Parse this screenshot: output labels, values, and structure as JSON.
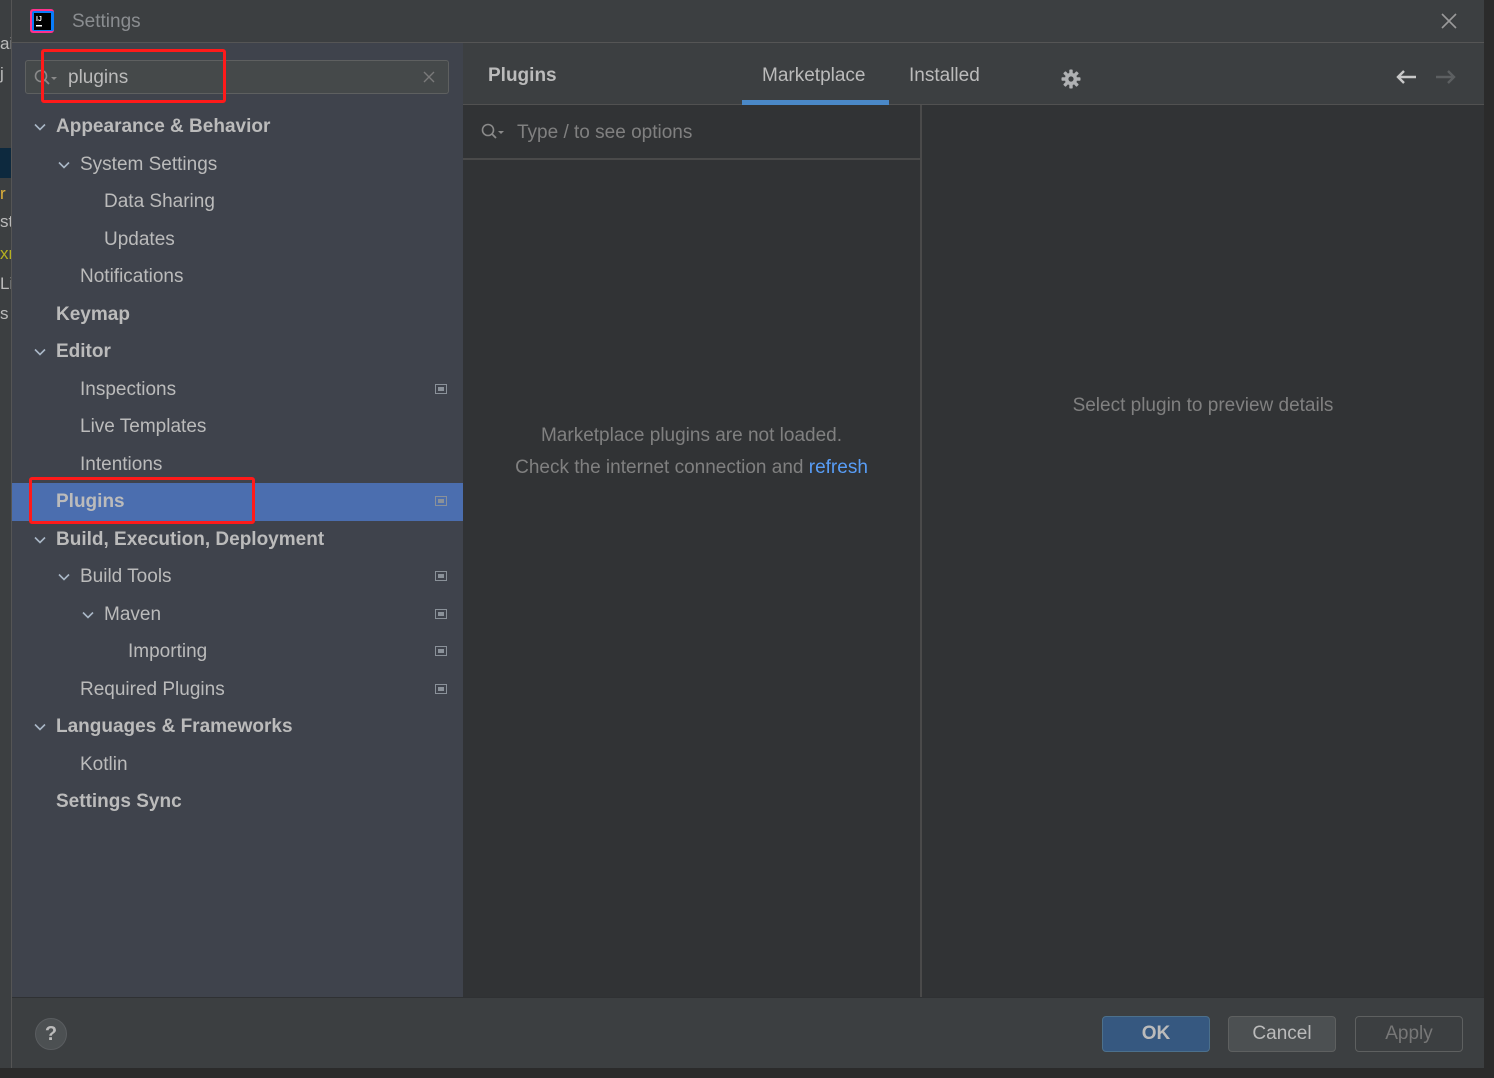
{
  "window": {
    "title": "Settings",
    "close_icon": "close-icon"
  },
  "background_ide": {
    "fragments": [
      "ai",
      "j",
      "r",
      "st",
      "xr",
      "Li",
      "s"
    ]
  },
  "sidebar": {
    "search": {
      "value": "plugins",
      "placeholder": ""
    },
    "tree": [
      {
        "label": "Appearance & Behavior",
        "level": 0,
        "bold": true,
        "expanded": true,
        "project_icon": false
      },
      {
        "label": "System Settings",
        "level": 1,
        "bold": false,
        "expanded": true,
        "project_icon": false
      },
      {
        "label": "Data Sharing",
        "level": 2,
        "bold": false,
        "project_icon": false
      },
      {
        "label": "Updates",
        "level": 2,
        "bold": false,
        "project_icon": false
      },
      {
        "label": "Notifications",
        "level": 1,
        "bold": false,
        "project_icon": false
      },
      {
        "label": "Keymap",
        "level": 0,
        "bold": true,
        "project_icon": false
      },
      {
        "label": "Editor",
        "level": 0,
        "bold": true,
        "expanded": true,
        "project_icon": false
      },
      {
        "label": "Inspections",
        "level": 1,
        "bold": false,
        "project_icon": true
      },
      {
        "label": "Live Templates",
        "level": 1,
        "bold": false,
        "project_icon": false
      },
      {
        "label": "Intentions",
        "level": 1,
        "bold": false,
        "project_icon": false
      },
      {
        "label": "Plugins",
        "level": 0,
        "bold": true,
        "selected": true,
        "project_icon": true
      },
      {
        "label": "Build, Execution, Deployment",
        "level": 0,
        "bold": true,
        "expanded": true,
        "project_icon": false
      },
      {
        "label": "Build Tools",
        "level": 1,
        "bold": false,
        "expanded": true,
        "project_icon": true
      },
      {
        "label": "Maven",
        "level": 2,
        "bold": false,
        "expanded": true,
        "project_icon": true
      },
      {
        "label": "Importing",
        "level": 3,
        "bold": false,
        "project_icon": true
      },
      {
        "label": "Required Plugins",
        "level": 1,
        "bold": false,
        "project_icon": true
      },
      {
        "label": "Languages & Frameworks",
        "level": 0,
        "bold": true,
        "expanded": true,
        "project_icon": false
      },
      {
        "label": "Kotlin",
        "level": 1,
        "bold": false,
        "project_icon": false
      },
      {
        "label": "Settings Sync",
        "level": 0,
        "bold": true,
        "project_icon": false
      }
    ]
  },
  "content": {
    "title": "Plugins",
    "tabs": [
      {
        "label": "Marketplace",
        "active": true
      },
      {
        "label": "Installed",
        "active": false
      }
    ],
    "plugin_search": {
      "value": "",
      "placeholder": "Type / to see options"
    },
    "empty_message": {
      "line1": "Marketplace plugins are not loaded.",
      "line2": "Check the internet connection and",
      "link": "refresh"
    },
    "details_message": "Select plugin to preview details"
  },
  "footer": {
    "help_label": "?",
    "ok_label": "OK",
    "cancel_label": "Cancel",
    "apply_label": "Apply",
    "apply_enabled": false
  },
  "annotations": {
    "highlight_color": "#ff1a1a",
    "highlighted": [
      "search-input",
      "tree-item-plugins"
    ]
  },
  "colors": {
    "accent": "#4a88c7",
    "selection": "#4b6eaf",
    "link": "#589df6",
    "primary_button": "#365880"
  }
}
